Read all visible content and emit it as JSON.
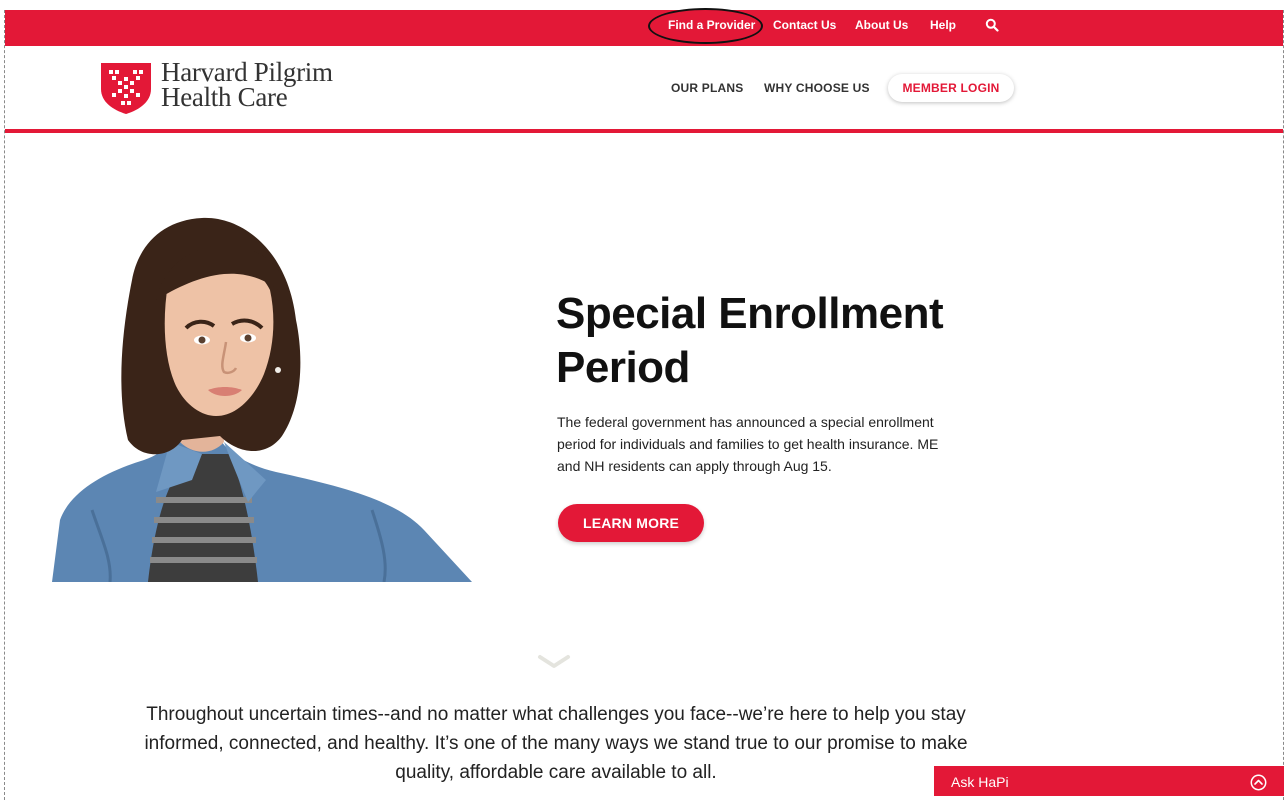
{
  "utility_nav": {
    "find_provider": "Find a Provider",
    "contact_us": "Contact Us",
    "about_us": "About Us",
    "help": "Help",
    "search_icon": "search-icon"
  },
  "brand": {
    "name_line1": "Harvard Pilgrim",
    "name_line2": "Health Care",
    "accent_color": "#e31837"
  },
  "main_nav": {
    "our_plans": "OUR PLANS",
    "why_choose_us": "WHY CHOOSE US",
    "member_login": "MEMBER LOGIN"
  },
  "hero": {
    "title_line1": "Special Enrollment",
    "title_line2": "Period",
    "body": "The federal government has announced a special enrollment period for individuals and families to get health insurance. ME and NH residents can apply through Aug 15.",
    "cta": "LEARN MORE"
  },
  "promise": {
    "text_line1": "Throughout uncertain times--and no matter what challenges you face--we’re here to help you stay",
    "text_line2": "informed, connected, and healthy. It’s one of the many ways we stand true to our promise to make",
    "text_line3": "quality, affordable care available to all."
  },
  "chat": {
    "label": "Ask HaPi",
    "toggle_icon": "chevron-up-circle-icon"
  }
}
